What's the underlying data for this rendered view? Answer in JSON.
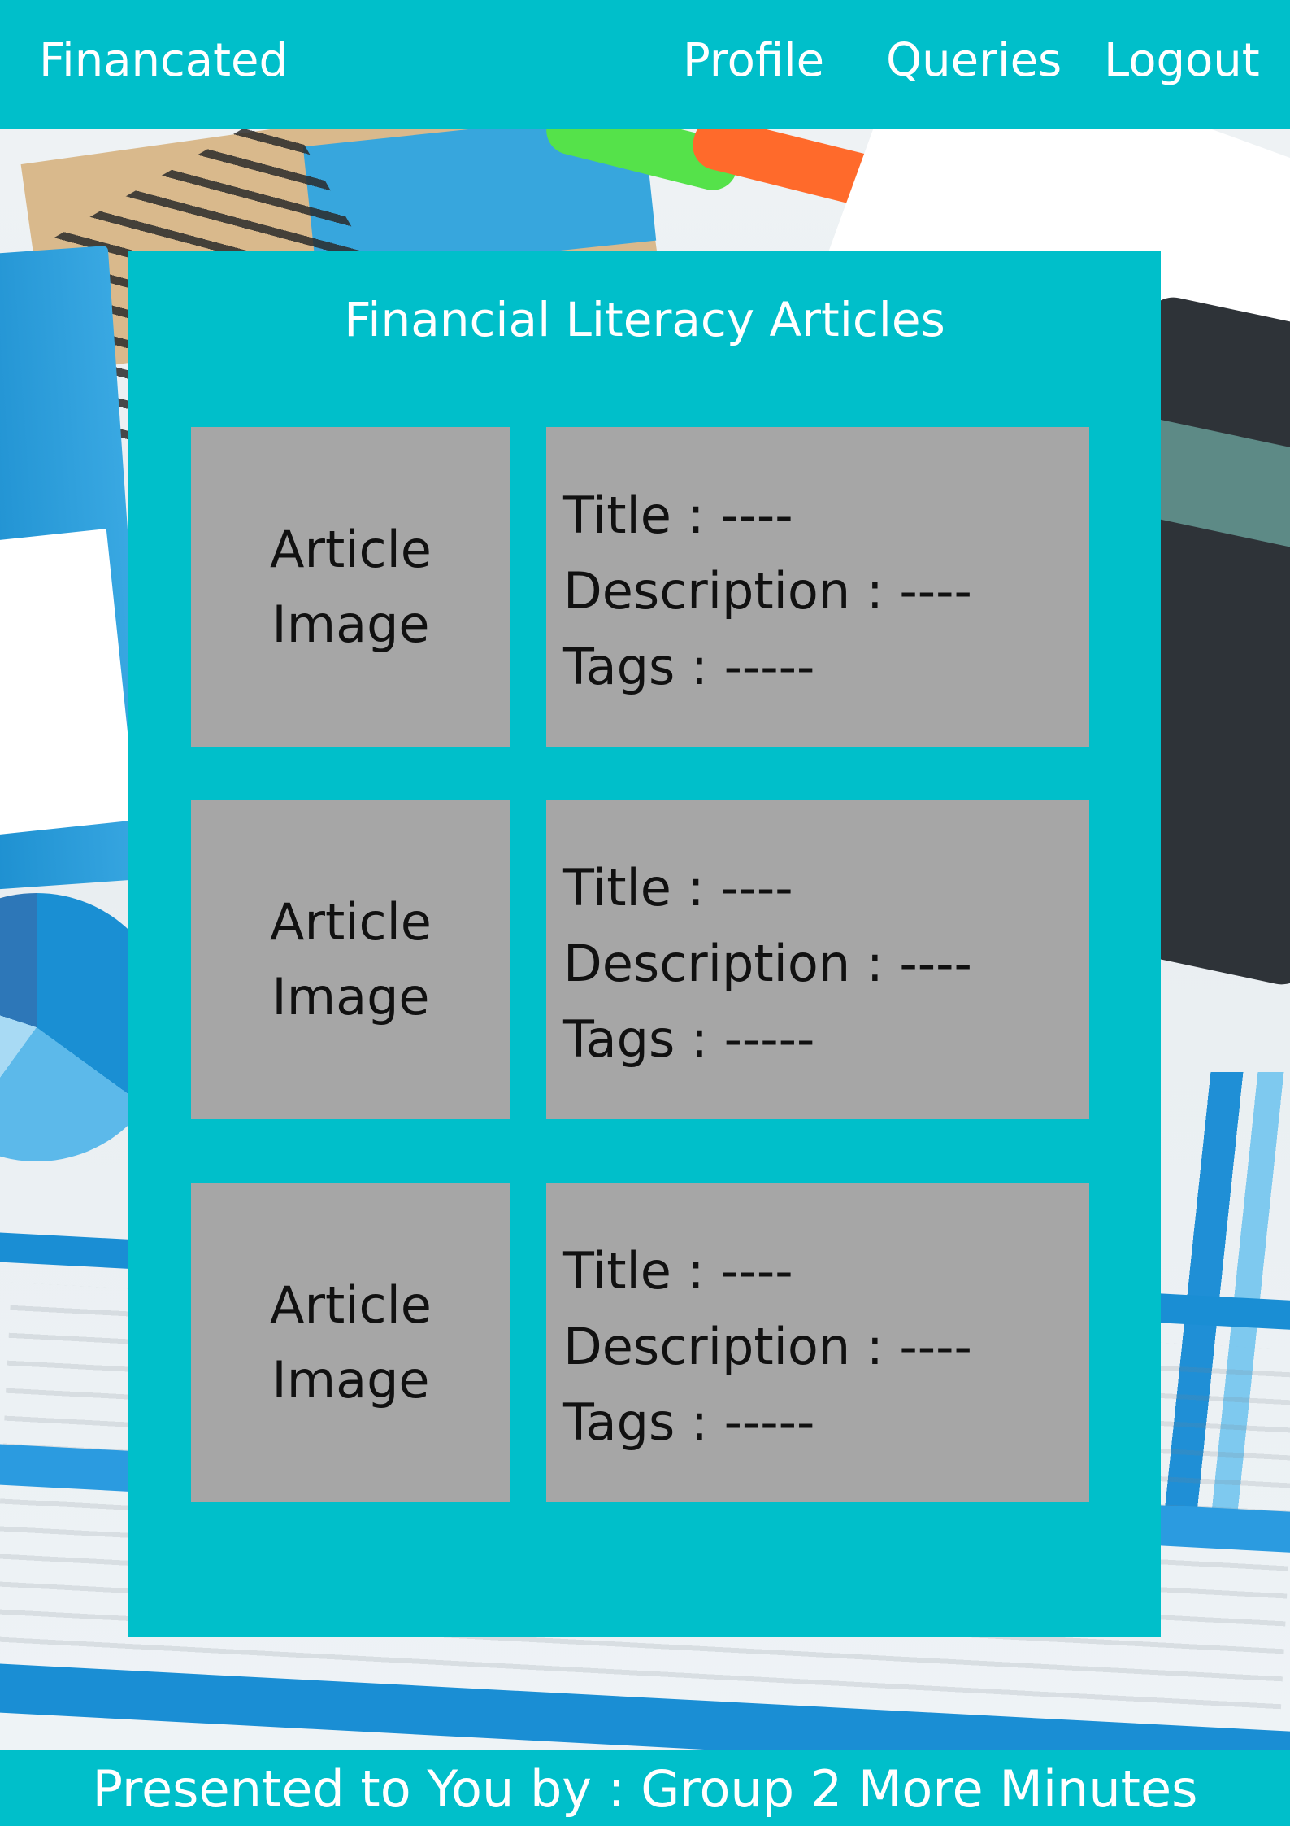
{
  "header": {
    "brand": "Financated",
    "nav": {
      "profile": "Profile",
      "queries": "Queries",
      "logout": "Logout"
    }
  },
  "main": {
    "title": "Financial Literacy Articles",
    "articles": [
      {
        "image_line1": "Article",
        "image_line2": "Image",
        "title": "Title : ----",
        "description": "Description : ----",
        "tags": "Tags : -----"
      },
      {
        "image_line1": "Article",
        "image_line2": "Image",
        "title": "Title : ----",
        "description": "Description : ----",
        "tags": "Tags : -----"
      },
      {
        "image_line1": "Article",
        "image_line2": "Image",
        "title": "Title : ----",
        "description": "Description : ----",
        "tags": "Tags : -----"
      }
    ]
  },
  "footer": {
    "text": "Presented to You by : Group 2 More Minutes"
  },
  "colors": {
    "accent": "#00bfca",
    "card": "#a6a6a6",
    "text_light": "#ffffff",
    "text_dark": "#111111"
  }
}
